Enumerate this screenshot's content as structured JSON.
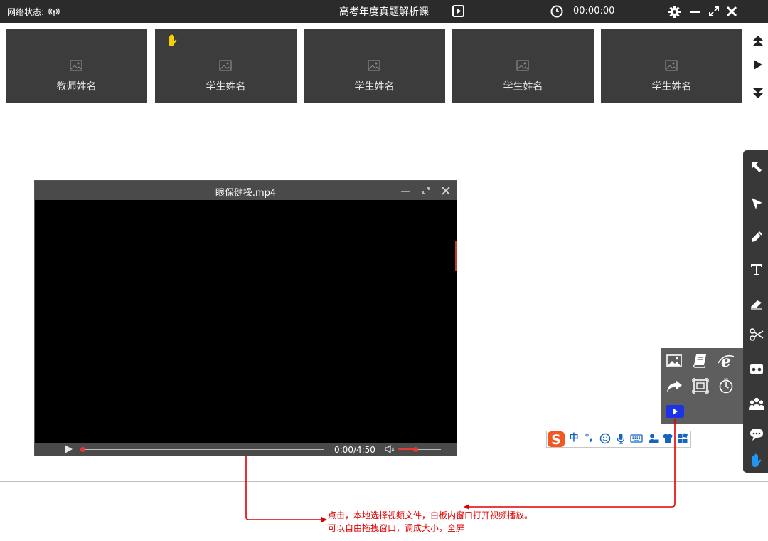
{
  "topbar": {
    "network_label": "网络状态:",
    "title": "高考年度真题解析课",
    "timer": "00:00:00"
  },
  "strip": {
    "tiles": [
      {
        "label": "教师姓名",
        "hand_raised": false
      },
      {
        "label": "学生姓名",
        "hand_raised": true
      },
      {
        "label": "学生姓名",
        "hand_raised": false
      },
      {
        "label": "学生姓名",
        "hand_raised": false
      },
      {
        "label": "学生姓名",
        "hand_raised": false
      }
    ]
  },
  "video_window": {
    "title": "眼保健操.mp4",
    "time": "0:00/4:50",
    "progress": 0,
    "volume": 0.4
  },
  "right_toolbar": {
    "tools": [
      "resize-arrow-icon",
      "pointer-icon",
      "pencil-icon",
      "text-icon",
      "eraser-icon",
      "scissors-icon",
      "toolbox-icon",
      "users-icon",
      "chat-icon",
      "hand-icon"
    ],
    "active": "hand-icon"
  },
  "popup_panel": {
    "tools": [
      "image-icon",
      "book-icon",
      "browser-icon",
      "share-icon",
      "screenshot-icon",
      "timer-icon",
      "video-icon"
    ],
    "highlighted": "video-icon"
  },
  "ime": {
    "mode_label": "中",
    "punct_label": "°,",
    "icons": [
      "emoji-icon",
      "mic-icon",
      "keyboard-icon",
      "user-icon",
      "skin-icon",
      "grid-icon"
    ]
  },
  "annotation": {
    "line1": "点击，本地选择视频文件，白板内窗口打开视频播放。",
    "line2": "可以自由拖拽窗口，调成大小，全屏"
  },
  "colors": {
    "topbar": "#2b2b2b",
    "tile": "#3c3c3c",
    "accent_red": "#e53935",
    "annotation_red": "#e00000",
    "highlight_blue": "#1a35e8",
    "ime_blue": "#1565c0",
    "hand_yellow": "#f5d000",
    "hand_blue": "#2196f3"
  }
}
